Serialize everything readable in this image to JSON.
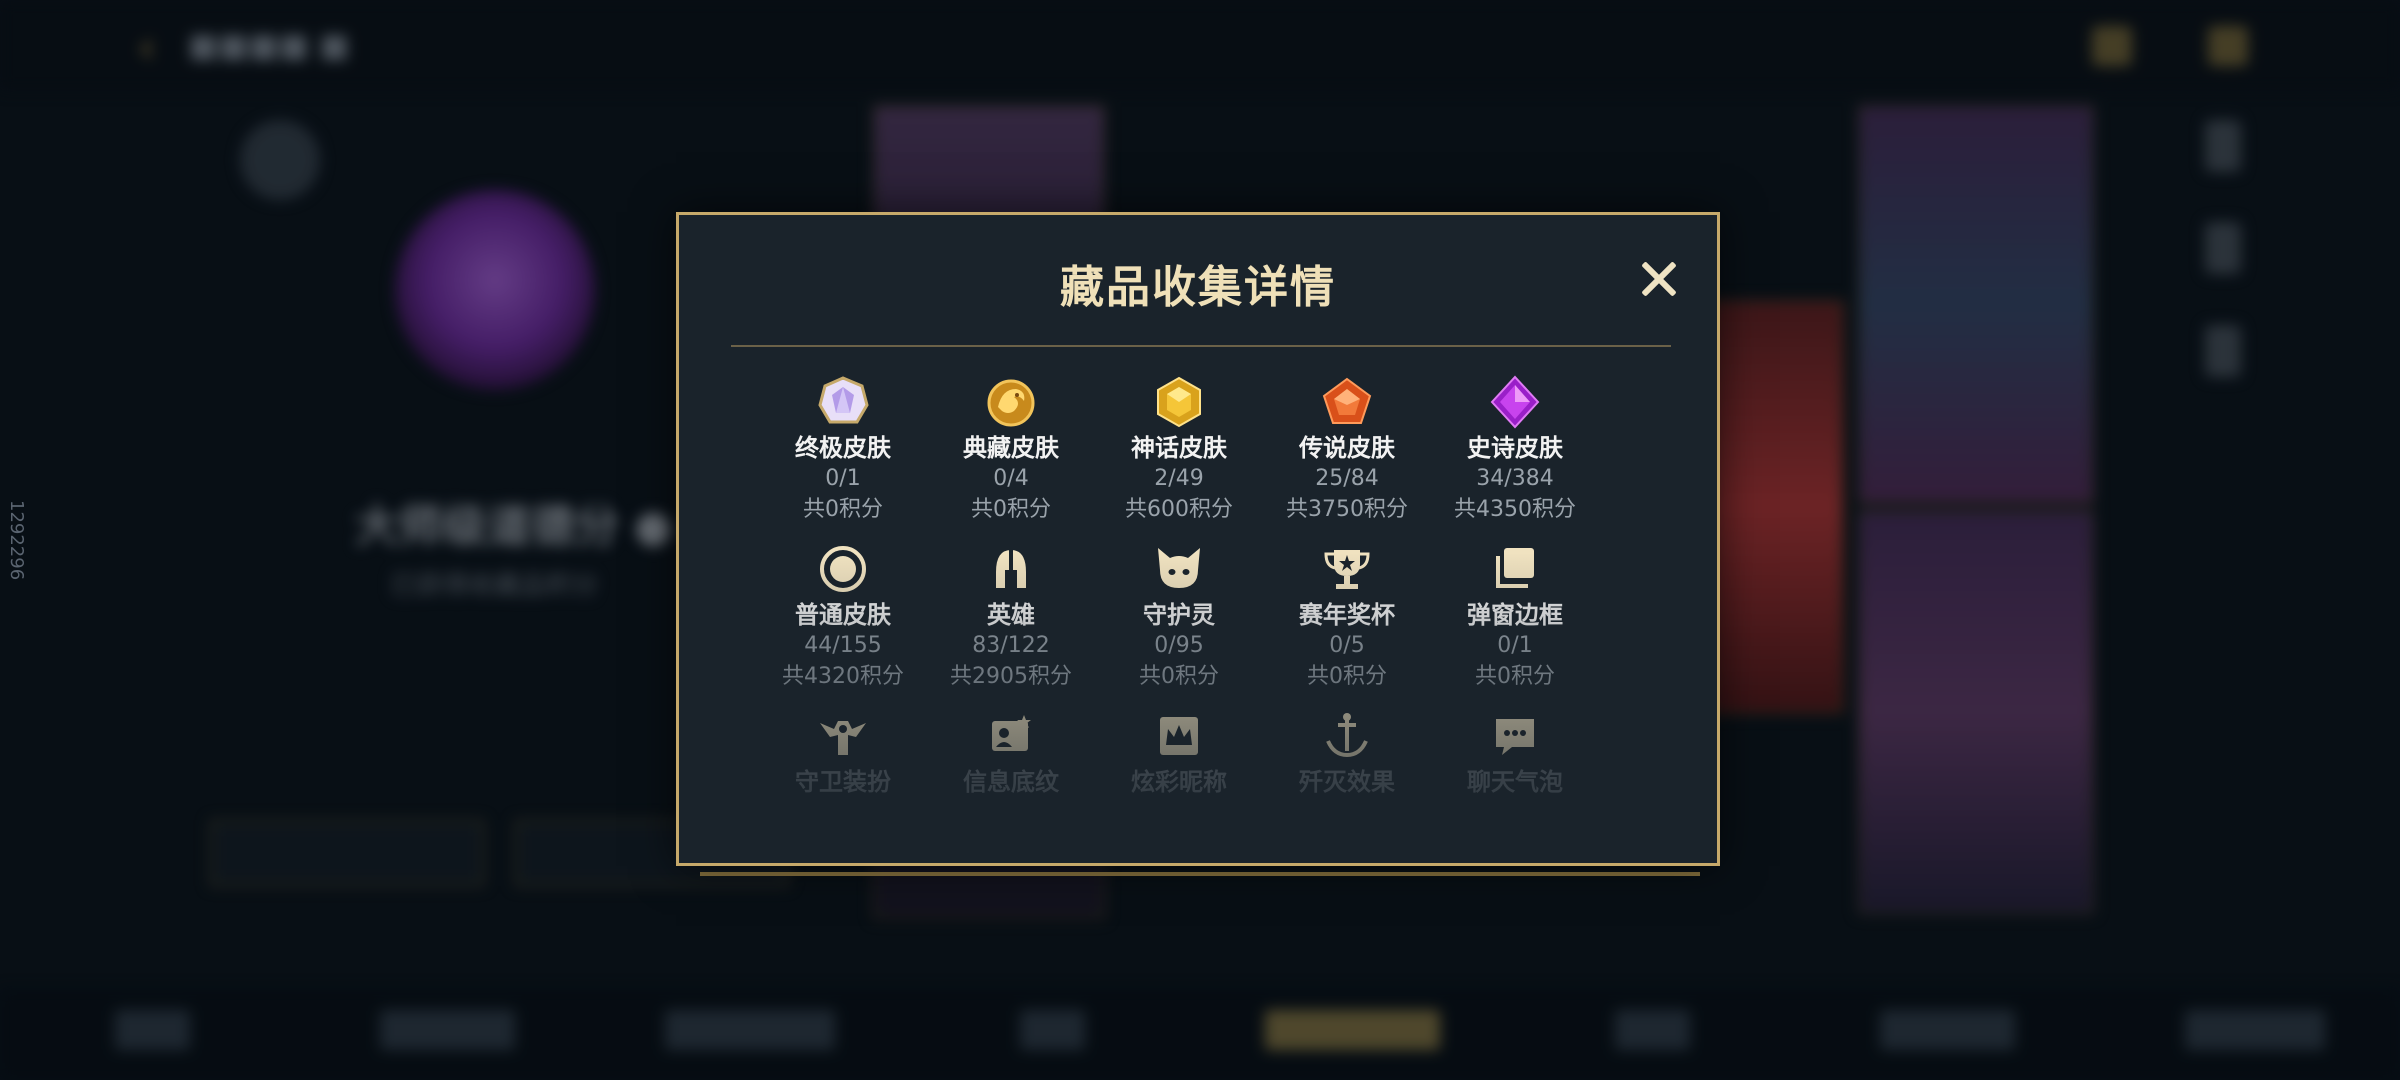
{
  "background": {
    "profile_name": "大师级道德分 ●",
    "profile_sub": "已获得收藏品积分",
    "side_id": "1292296"
  },
  "modal": {
    "title": "藏品收集详情",
    "close_icon": "close-x-icon",
    "rows": [
      [
        {
          "icon": "ultimate-skin-gem-icon",
          "name": "终极皮肤",
          "count": "0/1",
          "points": "共0积分"
        },
        {
          "icon": "treasure-skin-dragon-icon",
          "name": "典藏皮肤",
          "count": "0/4",
          "points": "共0积分"
        },
        {
          "icon": "myth-skin-gem-icon",
          "name": "神话皮肤",
          "count": "2/49",
          "points": "共600积分"
        },
        {
          "icon": "legend-skin-gem-icon",
          "name": "传说皮肤",
          "count": "25/84",
          "points": "共3750积分"
        },
        {
          "icon": "epic-skin-gem-icon",
          "name": "史诗皮肤",
          "count": "34/384",
          "points": "共4350积分"
        }
      ],
      [
        {
          "icon": "normal-skin-ring-icon",
          "name": "普通皮肤",
          "count": "44/155",
          "points": "共4320积分"
        },
        {
          "icon": "hero-helmet-icon",
          "name": "英雄",
          "count": "83/122",
          "points": "共2905积分"
        },
        {
          "icon": "guardian-spirit-icon",
          "name": "守护灵",
          "count": "0/95",
          "points": "共0积分"
        },
        {
          "icon": "trophy-icon",
          "name": "赛年奖杯",
          "count": "0/5",
          "points": "共0积分"
        },
        {
          "icon": "popup-frame-icon",
          "name": "弹窗边框",
          "count": "0/1",
          "points": "共0积分"
        }
      ],
      [
        {
          "icon": "guard-outfit-icon",
          "name": "守卫装扮"
        },
        {
          "icon": "info-card-icon",
          "name": "信息底纹"
        },
        {
          "icon": "nickname-crown-icon",
          "name": "炫彩昵称"
        },
        {
          "icon": "elimination-effect-icon",
          "name": "歼灭效果"
        },
        {
          "icon": "chat-bubble-icon",
          "name": "聊天气泡"
        }
      ]
    ]
  },
  "colors": {
    "accent_gold": "#c6a96a",
    "modal_bg": "#1a232b",
    "text_white": "#f2f2f2",
    "text_gray": "#9aa3ab"
  }
}
